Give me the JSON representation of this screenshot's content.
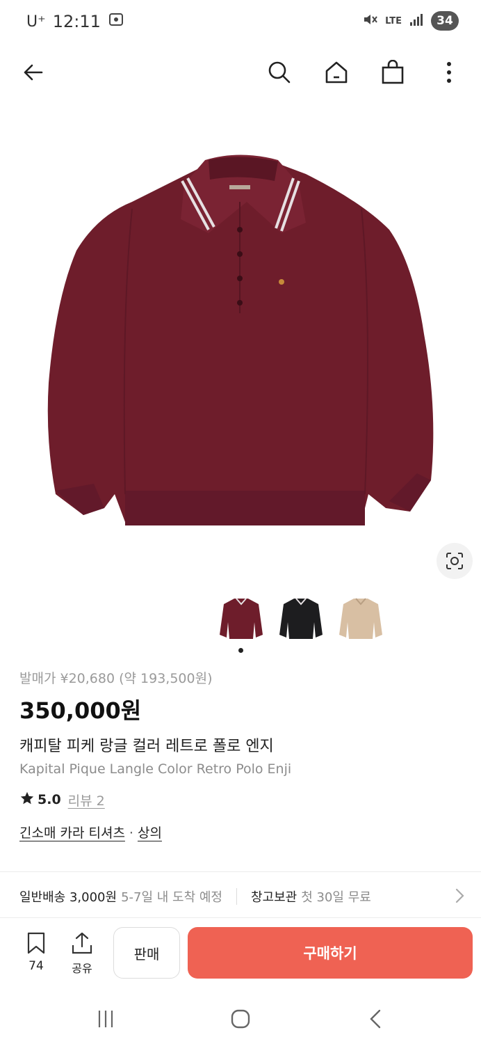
{
  "status_bar": {
    "carrier": "U⁺",
    "time": "12:11",
    "network": "LTE",
    "battery": "34"
  },
  "top_nav": {
    "icons": [
      "back-arrow-icon",
      "search-icon",
      "home-icon",
      "shopping-bag-icon",
      "more-vertical-icon"
    ]
  },
  "product": {
    "image_alt_colors": [
      "#6e1d2b",
      "#1d1d1f",
      "#d8bfa3"
    ],
    "release_price": "발매가 ¥20,680 (약 193,500원)",
    "price": "350,000원",
    "title_ko": "캐피탈 피케 랑글 컬러 레트로 폴로 엔지",
    "title_en": "Kapital Pique Langle Color Retro Polo Enji",
    "rating": "5.0",
    "review_label": "리뷰 2",
    "category": "긴소매 카라 티셔츠",
    "category_separator": "·",
    "subcategory": "상의"
  },
  "delivery": {
    "shipping_label": "일반배송 3,000원",
    "shipping_detail": "5-7일 내 도착 예정",
    "storage_label": "창고보관",
    "storage_detail": "첫 30일 무료"
  },
  "actions": {
    "wish_count": "74",
    "share_label": "공유",
    "sell_label": "판매",
    "buy_label": "구매하기"
  },
  "colors": {
    "accent": "#ef6253",
    "product_burgundy": "#6e1d2b"
  }
}
